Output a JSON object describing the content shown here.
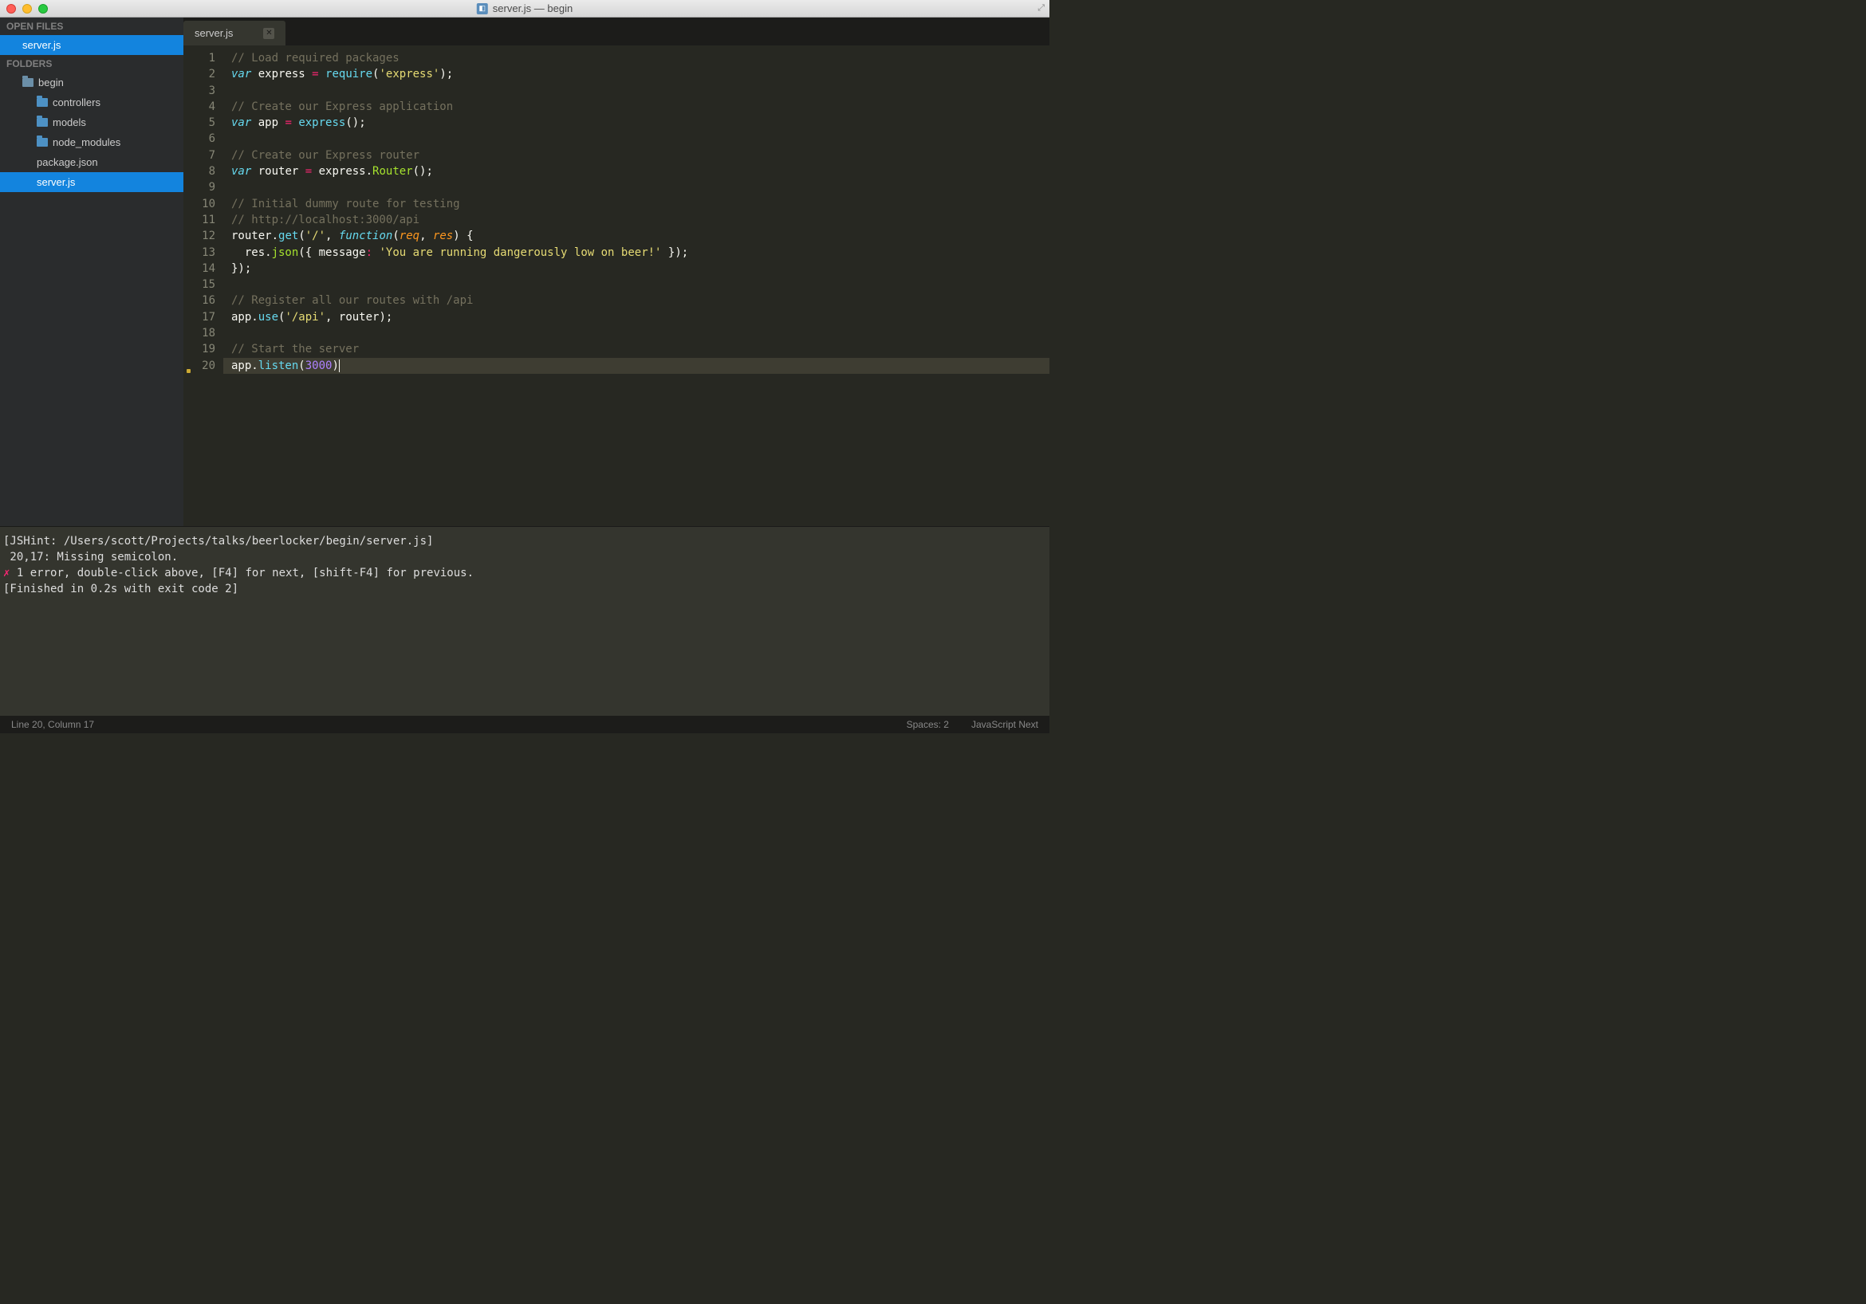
{
  "window": {
    "title": "server.js — begin"
  },
  "sidebar": {
    "open_files_header": "OPEN FILES",
    "folders_header": "FOLDERS",
    "open_files": [
      {
        "label": "server.js",
        "selected": true
      }
    ],
    "folder_root": {
      "label": "begin"
    },
    "tree": [
      {
        "label": "controllers",
        "type": "folder"
      },
      {
        "label": "models",
        "type": "folder"
      },
      {
        "label": "node_modules",
        "type": "folder"
      },
      {
        "label": "package.json",
        "type": "file"
      },
      {
        "label": "server.js",
        "type": "file",
        "selected": true
      }
    ]
  },
  "tabs": [
    {
      "label": "server.js"
    }
  ],
  "code": {
    "lines": [
      {
        "n": 1,
        "tokens": [
          [
            "comment",
            "// Load required packages"
          ]
        ]
      },
      {
        "n": 2,
        "tokens": [
          [
            "keyword",
            "var"
          ],
          [
            "plain",
            " express "
          ],
          [
            "op",
            "="
          ],
          [
            "plain",
            " "
          ],
          [
            "func",
            "require"
          ],
          [
            "plain",
            "("
          ],
          [
            "string",
            "'express'"
          ],
          [
            "plain",
            ");"
          ]
        ]
      },
      {
        "n": 3,
        "tokens": []
      },
      {
        "n": 4,
        "tokens": [
          [
            "comment",
            "// Create our Express application"
          ]
        ]
      },
      {
        "n": 5,
        "tokens": [
          [
            "keyword",
            "var"
          ],
          [
            "plain",
            " app "
          ],
          [
            "op",
            "="
          ],
          [
            "plain",
            " "
          ],
          [
            "func",
            "express"
          ],
          [
            "plain",
            "();"
          ]
        ]
      },
      {
        "n": 6,
        "tokens": []
      },
      {
        "n": 7,
        "tokens": [
          [
            "comment",
            "// Create our Express router"
          ]
        ]
      },
      {
        "n": 8,
        "tokens": [
          [
            "keyword",
            "var"
          ],
          [
            "plain",
            " router "
          ],
          [
            "op",
            "="
          ],
          [
            "plain",
            " express."
          ],
          [
            "method",
            "Router"
          ],
          [
            "plain",
            "();"
          ]
        ]
      },
      {
        "n": 9,
        "tokens": []
      },
      {
        "n": 10,
        "tokens": [
          [
            "comment",
            "// Initial dummy route for testing"
          ]
        ]
      },
      {
        "n": 11,
        "tokens": [
          [
            "comment",
            "// http://localhost:3000/api"
          ]
        ]
      },
      {
        "n": 12,
        "tokens": [
          [
            "plain",
            "router."
          ],
          [
            "func",
            "get"
          ],
          [
            "plain",
            "("
          ],
          [
            "string",
            "'/'"
          ],
          [
            "plain",
            ", "
          ],
          [
            "keyword",
            "function"
          ],
          [
            "plain",
            "("
          ],
          [
            "param",
            "req"
          ],
          [
            "plain",
            ", "
          ],
          [
            "param",
            "res"
          ],
          [
            "plain",
            ") {"
          ]
        ]
      },
      {
        "n": 13,
        "tokens": [
          [
            "plain",
            "  res."
          ],
          [
            "method",
            "json"
          ],
          [
            "plain",
            "({ message"
          ],
          [
            "op",
            ":"
          ],
          [
            "plain",
            " "
          ],
          [
            "string",
            "'You are running dangerously low on beer!'"
          ],
          [
            "plain",
            " });"
          ]
        ]
      },
      {
        "n": 14,
        "tokens": [
          [
            "plain",
            "});"
          ]
        ]
      },
      {
        "n": 15,
        "tokens": []
      },
      {
        "n": 16,
        "tokens": [
          [
            "comment",
            "// Register all our routes with /api"
          ]
        ]
      },
      {
        "n": 17,
        "tokens": [
          [
            "plain",
            "app."
          ],
          [
            "func",
            "use"
          ],
          [
            "plain",
            "("
          ],
          [
            "string",
            "'/api'"
          ],
          [
            "plain",
            ", router);"
          ]
        ]
      },
      {
        "n": 18,
        "tokens": []
      },
      {
        "n": 19,
        "tokens": [
          [
            "comment",
            "// Start the server"
          ]
        ]
      },
      {
        "n": 20,
        "tokens": [
          [
            "plain",
            "app."
          ],
          [
            "func",
            "listen"
          ],
          [
            "plain",
            "("
          ],
          [
            "number",
            "3000"
          ],
          [
            "plain",
            ")"
          ]
        ],
        "active": true,
        "mark": true
      }
    ]
  },
  "output": {
    "line1": "[JSHint: /Users/scott/Projects/talks/beerlocker/begin/server.js]",
    "blank1": "",
    "line2": " 20,17: Missing semicolon.",
    "blank2": "",
    "line3_pre": "✗",
    "line3": " 1 error, double-click above, [F4] for next, [shift-F4] for previous.",
    "blank3": "",
    "line4": "[Finished in 0.2s with exit code 2]"
  },
  "status": {
    "left": "Line 20, Column 17",
    "spaces": "Spaces: 2",
    "lang": "JavaScript Next"
  }
}
